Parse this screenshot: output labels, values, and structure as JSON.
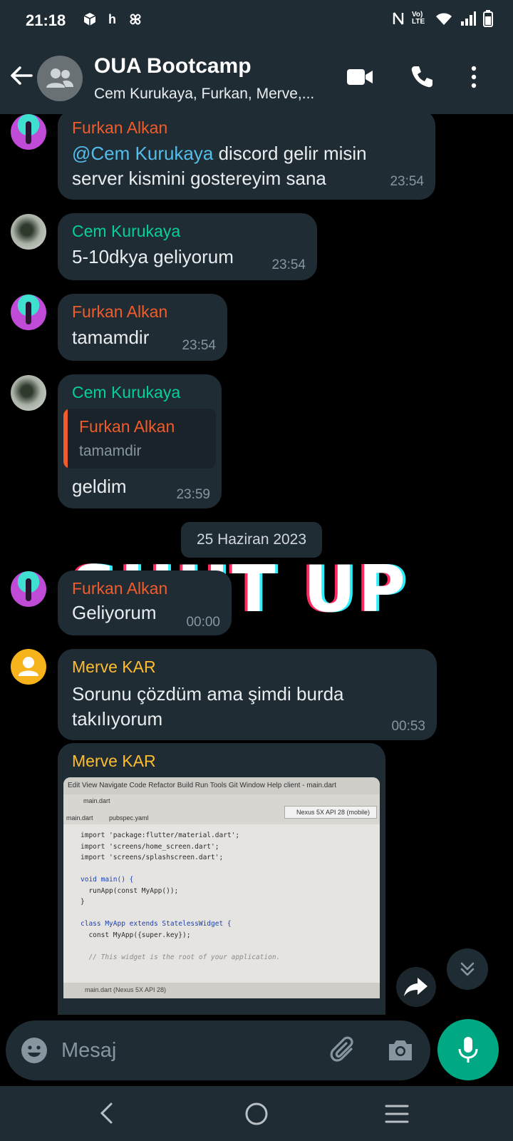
{
  "status_bar": {
    "time": "21:18",
    "left_icons": [
      "box-icon",
      "h",
      "pinwheel-icon"
    ],
    "right_icons": [
      "nfc-icon",
      "volte-icon",
      "wifi-icon",
      "signal-icon",
      "battery-icon"
    ],
    "h_glyph": "h",
    "volte": "Vo) LTE"
  },
  "header": {
    "title": "OUA Bootcamp",
    "subtitle": "Cem Kurukaya, Furkan, Merve,...",
    "icons": [
      "back-arrow-icon",
      "group-avatar-icon",
      "video-call-icon",
      "voice-call-icon",
      "more-vert-icon"
    ]
  },
  "colors": {
    "header_bg": "#1f2c34",
    "bubble_bg": "#1f2c34",
    "accent_green": "#00a884",
    "name_furkan": "#f15c2a",
    "name_cem": "#06cf9c",
    "name_merve": "#ffbc2d",
    "mention": "#53bdeb"
  },
  "messages": [
    {
      "sender": "Furkan Alkan",
      "mention": "@Cem Kurukaya",
      "text_line1_rest": " discord gelir misin",
      "text_line2": "server kismini gostereyim sana",
      "time": "23:54"
    },
    {
      "sender": "Cem Kurukaya",
      "text": "5-10dkya geliyorum",
      "time": "23:54"
    },
    {
      "sender": "Furkan Alkan",
      "text": "tamamdir",
      "time": "23:54"
    },
    {
      "sender": "Cem Kurukaya",
      "quote": {
        "sender": "Furkan Alkan",
        "text": "tamamdir"
      },
      "text": "geldim",
      "time": "23:59"
    },
    {
      "sender": "Furkan Alkan",
      "text": "Geliyorum",
      "time": "00:00"
    },
    {
      "sender": "Merve KAR",
      "text_line1": "Sorunu çözdüm ama şimdi burda",
      "text_line2": "takılıyorum",
      "time": "00:53"
    },
    {
      "sender": "Merve KAR",
      "type": "image"
    }
  ],
  "date_separator": "25 Haziran 2023",
  "sticker_text": "SHUT UP",
  "photo": {
    "menu": "Edit   View   Navigate   Code   Refactor   Build   Run   Tools   Git   Window   Help          client - main.dart",
    "breadcrumb": "main.dart",
    "tab1": "main.dart",
    "tab2": "pubspec.yaml",
    "device": "Nexus 5X API 28 (mobile)",
    "code": {
      "l1": "import 'package:flutter/material.dart';",
      "l2": "import 'screens/home_screen.dart';",
      "l3": "import 'screens/splashscreen.dart';",
      "l5": "void main() {",
      "l6": "  runApp(const MyApp());",
      "l7": "}",
      "l9": "class MyApp extends StatelessWidget {",
      "l10": "  const MyApp({super.key});",
      "l12": "  // This widget is the root of your application."
    },
    "bottom": "main.dart (Nexus 5X API 28)"
  },
  "composer": {
    "placeholder": "Mesaj",
    "icons": [
      "emoji-icon",
      "attach-icon",
      "camera-icon",
      "mic-icon"
    ]
  },
  "nav_bar": {
    "icons": [
      "nav-back-icon",
      "nav-home-icon",
      "nav-recents-icon"
    ]
  }
}
